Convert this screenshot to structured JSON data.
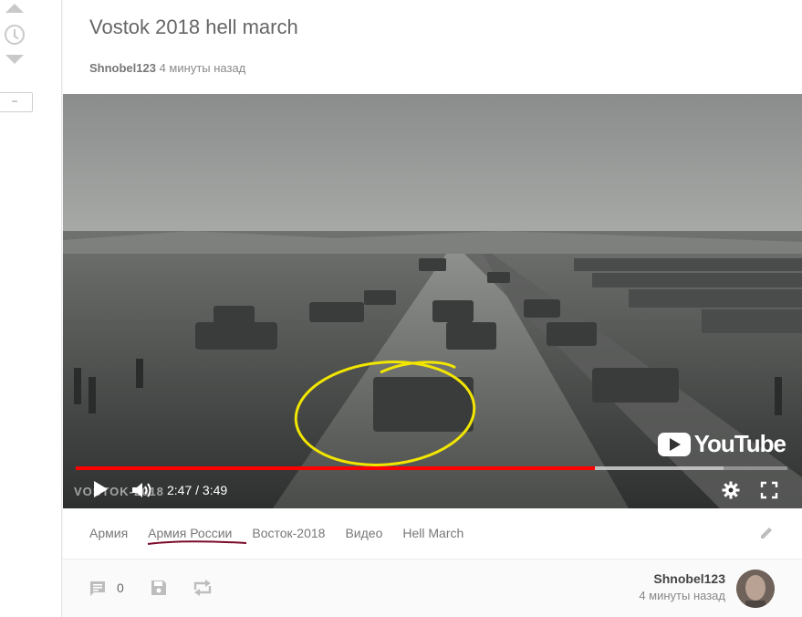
{
  "post": {
    "title": "Vostok 2018 hell march",
    "author": "Shnobel123",
    "time_ago": "4 минуты назад"
  },
  "rail": {
    "collapse_label": "−"
  },
  "video": {
    "current_time": "2:47",
    "duration": "3:49",
    "time_display": "2:47 / 3:49",
    "watermark": "VOSTOK-2018",
    "brand": "YouTube",
    "progress": 0.73,
    "buffered": 0.91,
    "progress_color": "#ff0000"
  },
  "tags": [
    {
      "label": "Армия"
    },
    {
      "label": "Армия России"
    },
    {
      "label": "Восток-2018"
    },
    {
      "label": "Видео"
    },
    {
      "label": "Hell March"
    }
  ],
  "footer": {
    "comments_count": "0",
    "author": "Shnobel123",
    "time_ago": "4 минуты назад"
  },
  "icons": [
    "arrow-up-icon",
    "clock-icon",
    "arrow-down-icon",
    "play-icon",
    "volume-icon",
    "gear-icon",
    "fullscreen-icon",
    "pencil-icon",
    "comment-icon",
    "save-icon",
    "share-icon"
  ],
  "colors": {
    "annotation_circle": "#f2e600",
    "annotation_underline": "#7a0a2a"
  }
}
